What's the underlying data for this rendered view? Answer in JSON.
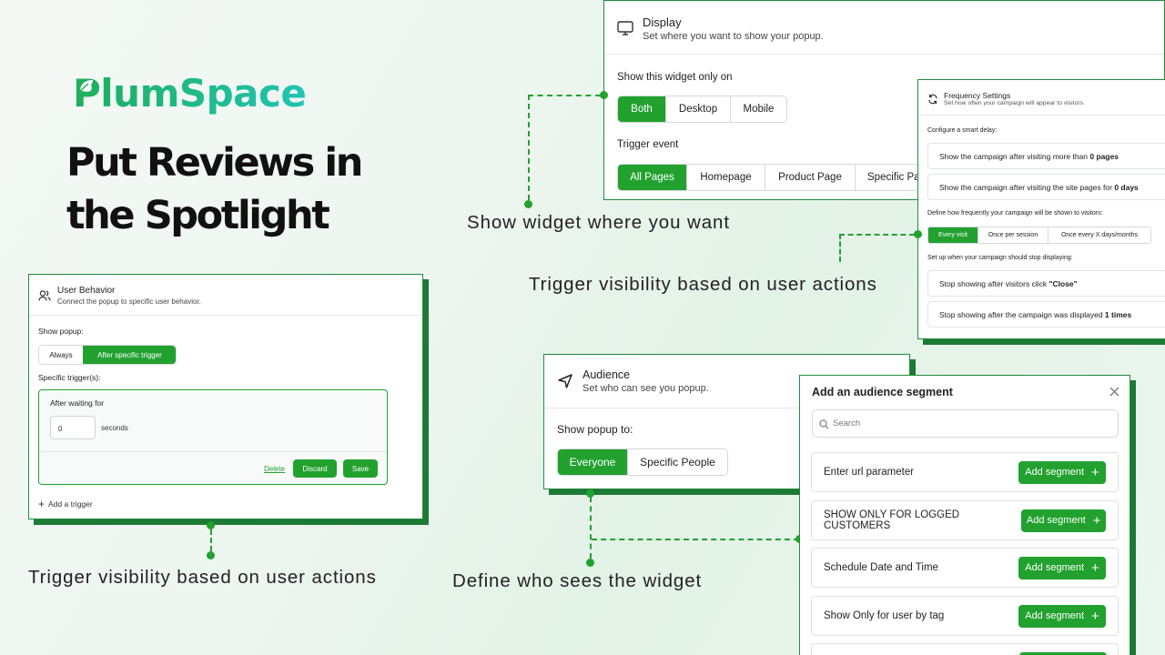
{
  "brand": {
    "logo": "PlumSpace",
    "headline_line1": "Put Reviews in",
    "headline_line2": "the Spotlight"
  },
  "captions": {
    "user_behavior": "Trigger visibility based on user actions",
    "display": "Show widget where you want",
    "frequency": "Trigger visibility based on user actions",
    "audience": "Define who sees the widget"
  },
  "user_behavior": {
    "title": "User Behavior",
    "subtitle": "Connect the popup to specific user behavior.",
    "show_popup_label": "Show popup:",
    "options": [
      "Always",
      "After specific trigger"
    ],
    "selected": "After specific trigger",
    "triggers_label": "Specific trigger(s):",
    "trigger_title": "After waiting for",
    "wait_value": "0",
    "wait_unit": "seconds",
    "delete_label": "Delete",
    "discard_label": "Discard",
    "save_label": "Save",
    "add_trigger_label": "Add a trigger"
  },
  "display": {
    "title": "Display",
    "subtitle": "Set where you want to show your popup.",
    "show_only_label": "Show this widget only on",
    "devices": [
      "Both",
      "Desktop",
      "Mobile"
    ],
    "selected_device": "Both",
    "trigger_event_label": "Trigger event",
    "events": [
      "All Pages",
      "Homepage",
      "Product Page",
      "Specific Pa"
    ],
    "selected_event": "All Pages"
  },
  "frequency": {
    "title": "Frequency Settings",
    "subtitle": "Set how often your campaign will appear to visitors.",
    "smart_delay_label": "Configure a smart delay:",
    "rule1_text": "Show the campaign after visiting more than ",
    "rule1_value": "0 pages",
    "rule2_text": "Show the campaign after visiting the site pages for ",
    "rule2_value": "0 days",
    "frequency_label": "Define how frequently your campaign will be shown to visitors:",
    "options": [
      "Every visit",
      "Once per session",
      "Once every X days/months"
    ],
    "selected": "Every visit",
    "stop_label": "Set up when your campaign should stop displaying:",
    "stop1_text": "Stop showing after visitors click ",
    "stop1_value": "\"Close\"",
    "stop2_text": "Stop showing after the campaign was displayed ",
    "stop2_value": "1 times"
  },
  "audience": {
    "title": "Audience",
    "subtitle": "Set who can see you popup.",
    "show_to_label": "Show popup to:",
    "options": [
      "Everyone",
      "Specific People"
    ],
    "selected": "Everyone"
  },
  "segment_modal": {
    "title": "Add an audience segment",
    "search_placeholder": "Search",
    "add_label": "Add segment",
    "items": [
      "Enter url parameter",
      "SHOW ONLY FOR LOGGED CUSTOMERS",
      "Schedule Date and Time",
      "Show Only for user by tag"
    ]
  },
  "colors": {
    "accent": "#22a12f",
    "shadow": "#1c7a34",
    "logo_teal": "#22c1b0"
  },
  "icons": [
    "leaf-icon",
    "users-icon",
    "monitor-icon",
    "refresh-icon",
    "navigation-icon",
    "search-icon",
    "close-icon",
    "plus-icon"
  ]
}
